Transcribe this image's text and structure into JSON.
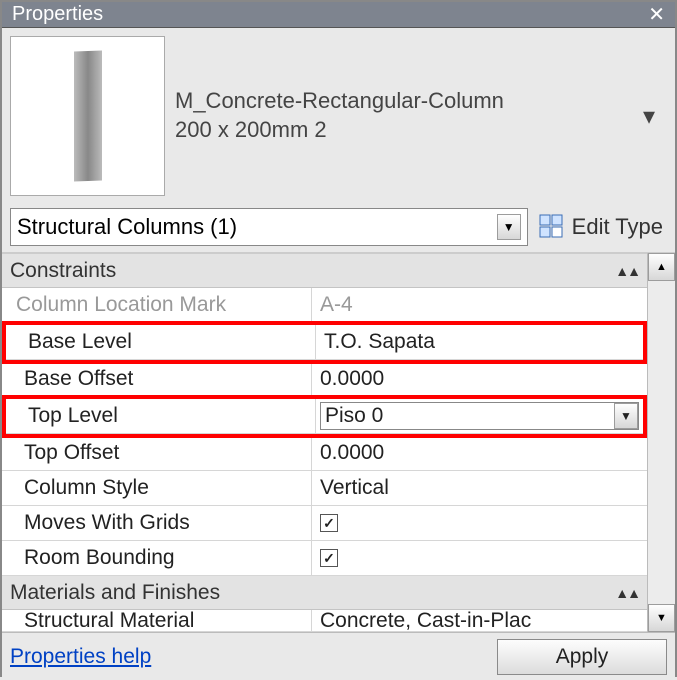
{
  "title": "Properties",
  "type": {
    "name": "M_Concrete-Rectangular-Column",
    "size": "200 x 200mm 2"
  },
  "selector": "Structural Columns (1)",
  "edit_type_label": "Edit Type",
  "sections": {
    "constraints": {
      "title": "Constraints",
      "rows": {
        "location_mark": {
          "label": "Column Location Mark",
          "value": "A-4"
        },
        "base_level": {
          "label": "Base Level",
          "value": "T.O. Sapata"
        },
        "base_offset": {
          "label": "Base Offset",
          "value": "0.0000"
        },
        "top_level": {
          "label": "Top Level",
          "value": "Piso 0"
        },
        "top_offset": {
          "label": "Top Offset",
          "value": "0.0000"
        },
        "column_style": {
          "label": "Column Style",
          "value": "Vertical"
        },
        "moves_grids": {
          "label": "Moves With Grids",
          "checked": true
        },
        "room_bounding": {
          "label": "Room Bounding",
          "checked": true
        }
      }
    },
    "materials": {
      "title": "Materials and Finishes",
      "rows": {
        "structural_material": {
          "label": "Structural Material",
          "value": "Concrete, Cast-in-Plac"
        }
      }
    }
  },
  "footer": {
    "help": "Properties help",
    "apply": "Apply"
  }
}
